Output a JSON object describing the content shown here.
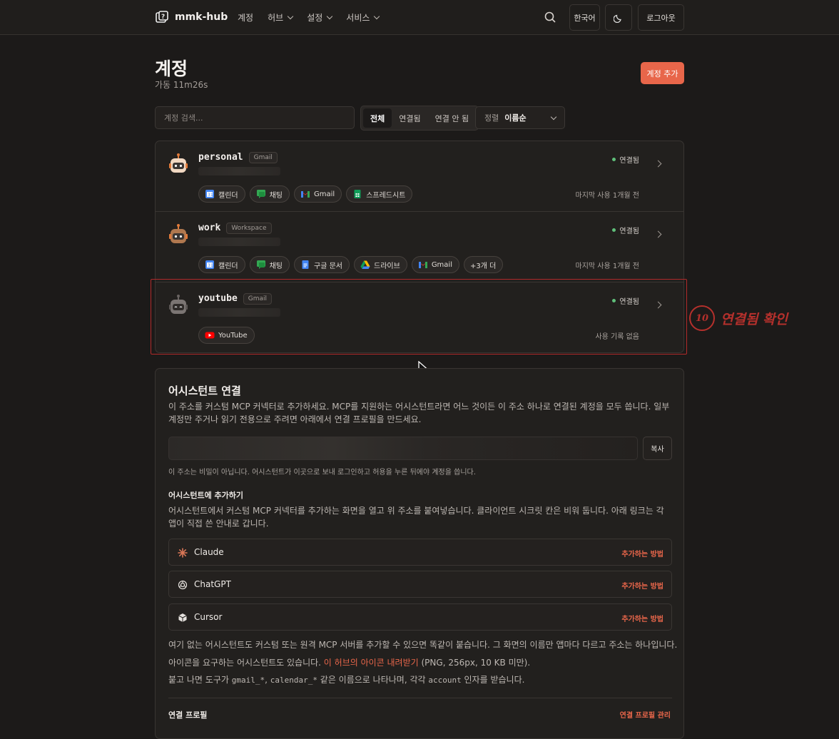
{
  "nav": {
    "brand": "mmk-hub",
    "links": [
      "계정",
      "허브",
      "설정",
      "서비스"
    ],
    "lang": "한국어",
    "logout": "로그아웃",
    "icons": [
      "search-icon",
      "moon-icon"
    ]
  },
  "page": {
    "title": "계정",
    "uptime": "가동 11m26s",
    "add_button": "계정 추가"
  },
  "filters": {
    "search_placeholder": "계정 검색...",
    "segments": [
      "전체",
      "연결됨",
      "연결 안 됨"
    ],
    "sort_label": "정렬",
    "sort_value": "이름순"
  },
  "accounts": [
    {
      "name": "personal",
      "badge": "Gmail",
      "status": "연결됨",
      "last_use": "마지막 사용 1개월 전",
      "chips": [
        {
          "label": "캘린더",
          "icon": "calendar-icon"
        },
        {
          "label": "채팅",
          "icon": "chat-icon"
        },
        {
          "label": "Gmail",
          "icon": "gmail-icon"
        },
        {
          "label": "스프레드시트",
          "icon": "sheets-icon"
        }
      ]
    },
    {
      "name": "work",
      "badge": "Workspace",
      "status": "연결됨",
      "last_use": "마지막 사용 1개월 전",
      "chips": [
        {
          "label": "캘린더",
          "icon": "calendar-icon"
        },
        {
          "label": "채팅",
          "icon": "chat-icon"
        },
        {
          "label": "구글 문서",
          "icon": "docs-icon"
        },
        {
          "label": "드라이브",
          "icon": "drive-icon"
        },
        {
          "label": "Gmail",
          "icon": "gmail-icon"
        },
        {
          "label": "+3개 더",
          "icon": ""
        }
      ]
    },
    {
      "name": "youtube",
      "badge": "Gmail",
      "status": "연결됨",
      "last_use": "사용 기록 없음",
      "chips": [
        {
          "label": "YouTube",
          "icon": "youtube-icon"
        }
      ]
    }
  ],
  "annotation": {
    "number": "10",
    "text": "연결됨 확인",
    "color": "#b5302c"
  },
  "assistant": {
    "title": "어시스턴트 연결",
    "desc": "이 주소를 커스텀 MCP 커넥터로 추가하세요. MCP를 지원하는 어시스턴트라면 어느 것이든 이 주소 하나로 연결된 계정을 모두 씁니다. 일부 계정만 주거나 읽기 전용으로 주려면 아래에서 연결 프로필을 만드세요.",
    "copy": "복사",
    "url_note": "이 주소는 비밀이 아닙니다. 어시스턴트가 이곳으로 보내 로그인하고 허용을 누른 뒤에야 계정을 씁니다.",
    "add_head": "어시스턴트에 추가하기",
    "add_desc": "어시스턴트에서 커스텀 MCP 커넥터를 추가하는 화면을 열고 위 주소를 붙여넣습니다. 클라이언트 시크릿 칸은 비워 둡니다. 아래 링크는 각 앱이 직접 쓴 안내로 갑니다.",
    "clients": [
      {
        "name": "Claude",
        "how": "추가하는 방법",
        "icon": "claude-icon"
      },
      {
        "name": "ChatGPT",
        "how": "추가하는 방법",
        "icon": "openai-icon"
      },
      {
        "name": "Cursor",
        "how": "추가하는 방법",
        "icon": "cursor-icon"
      }
    ],
    "para1": "여기 없는 어시스턴트도 커스텀 또는 원격 MCP 서버를 추가할 수 있으면 똑같이 붙습니다. 그 화면의 이름만 앱마다 다르고 주소는 하나입니다.",
    "para2_pre": "아이콘을 요구하는 어시스턴트도 있습니다. ",
    "para2_link": "이 허브의 아이콘 내려받기",
    "para2_post": " (PNG, 256px, 10 KB 미만).",
    "para3_pre": "붙고 나면 도구가 ",
    "para3_code1": "gmail_*",
    "para3_sep": ", ",
    "para3_code2": "calendar_*",
    "para3_mid": " 같은 이름으로 나타나며, 각각 ",
    "para3_code3": "account",
    "para3_post": " 인자를 받습니다.",
    "profile_head": "연결 프로필",
    "profile_manage": "연결 프로필 관리"
  },
  "colors": {
    "accent": "#e8664a",
    "status_dot": "#5fbf7a",
    "background": "#1c1a19"
  }
}
